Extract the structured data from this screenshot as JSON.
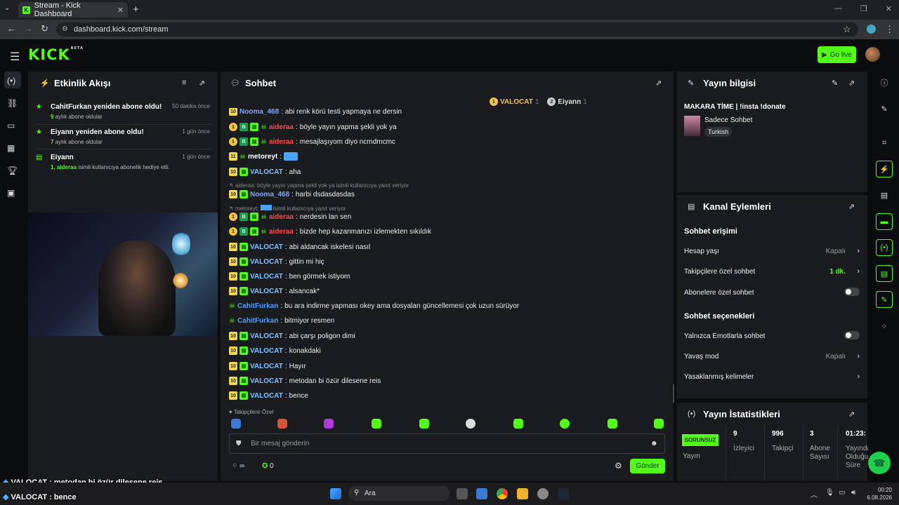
{
  "browser": {
    "tab_title": "Stream - Kick Dashboard",
    "url": "dashboard.kick.com/stream"
  },
  "header": {
    "logo": "KICK",
    "logo_beta": "BETA",
    "go_live": "Go live"
  },
  "activity": {
    "title": "Etkinlik Akışı",
    "items": [
      {
        "title": "CahitFurkan yeniden abone oldu!",
        "count": "9",
        "sub": "aylık abone oldular",
        "when": "50 dakika önce"
      },
      {
        "title": "Eiyann yeniden abone oldu!",
        "count": "7",
        "sub": "aylık abone oldular",
        "when": "1 gün önce"
      },
      {
        "title": "Eiyann",
        "count": "1, aideraa",
        "sub": "isimli kullanıcıya abonelik hediye etti.",
        "when": "1 gün önce"
      }
    ]
  },
  "chat": {
    "title": "Sohbet",
    "pinned": [
      {
        "rank": "1",
        "name": "VALOCAT",
        "count": "1"
      },
      {
        "rank": "2",
        "name": "Eiyann",
        "count": "1"
      }
    ],
    "messages": [
      {
        "name": "Nooma_468",
        "text": "abi renk körü testi yapmaya ne dersin",
        "color": "#7fa7ff"
      },
      {
        "name": "aideraa",
        "text": "böyle yayın yapma şekli yok ya",
        "color": "#ff4a4a"
      },
      {
        "name": "aideraa",
        "text": "mesajlaşıyom diyo ncmdmcmc",
        "color": "#ff4a4a"
      },
      {
        "name": "metoreyt",
        "text": "",
        "color": "#ffffff"
      },
      {
        "name": "VALOCAT",
        "text": "aha",
        "color": "#7fc4ff"
      },
      {
        "name": "Nooma_468",
        "text": "harbi dsdasdasdas",
        "color": "#7fa7ff"
      },
      {
        "name": "aideraa",
        "text": "nerdesin lan sen",
        "color": "#ff4a4a"
      },
      {
        "name": "aideraa",
        "text": "bizde hep kazanmanızı izlemekten sıkıldık",
        "color": "#ff4a4a"
      },
      {
        "name": "VALOCAT",
        "text": "abi aldancak iskelesi nasıl",
        "color": "#7fc4ff"
      },
      {
        "name": "VALOCAT",
        "text": "gittin mi hiç",
        "color": "#7fc4ff"
      },
      {
        "name": "VALOCAT",
        "text": "ben görmek istiyom",
        "color": "#7fc4ff"
      },
      {
        "name": "VALOCAT",
        "text": "alsancak*",
        "color": "#7fc4ff"
      },
      {
        "name": "CahitFurkan",
        "text": "bu ara indirme yapması okey ama dosyaları güncellemesi çok uzun sürüyor",
        "color": "#4d9eff"
      },
      {
        "name": "CahitFurkan",
        "text": "bitmiyor resmen",
        "color": "#4d9eff"
      },
      {
        "name": "VALOCAT",
        "text": "abi çarşı poligon dimi",
        "color": "#7fc4ff"
      },
      {
        "name": "VALOCAT",
        "text": "konakdaki",
        "color": "#7fc4ff"
      },
      {
        "name": "VALOCAT",
        "text": "Hayır",
        "color": "#7fc4ff"
      },
      {
        "name": "VALOCAT",
        "text": "metodan bi özür dilesene reis",
        "color": "#7fc4ff"
      },
      {
        "name": "VALOCAT",
        "text": "bence",
        "color": "#7fc4ff"
      }
    ],
    "reply1_user": "aideraa",
    "reply1_text": "böyle yayın yapma şekli yok ya isimli kullanıcıya yanıt veriyor",
    "reply2_user": "metoreyt",
    "reply2_text": "isimli kullanıcıya yanıt veriyor",
    "followers_only": "Takipçilere Özel",
    "placeholder": "Bir mesaj gönderin",
    "send": "Gönder",
    "infinity": "∞",
    "points": "0"
  },
  "stream_info": {
    "title": "Yayın bilgisi",
    "stream_title": "MAKARA TİME | !insta !donate",
    "category": "Sadece Sohbet",
    "language": "Turkish"
  },
  "channel_actions": {
    "title": "Kanal Eylemleri",
    "chat_access": "Sohbet erişimi",
    "account_age": "Hesap yaşı",
    "account_age_value": "Kapalı",
    "followers_chat": "Takipçilere özel sohbet",
    "followers_chat_value": "1 dk.",
    "subs_chat": "Abonelere özel sohbet",
    "chat_options": "Sohbet seçenekleri",
    "emote_only": "Yalnızca Emotlarla sohbet",
    "slow_mode": "Yavaş mod",
    "slow_mode_value": "Kapalı",
    "banned_words": "Yasaklanmış kelimeler"
  },
  "stats": {
    "title": "Yayın İstatistikleri",
    "status": "SORUNSUZ",
    "status_label": "Yayın",
    "viewers": "9",
    "viewers_label": "İzleyici",
    "followers": "996",
    "followers_label": "Takipçi",
    "subs": "3",
    "subs_label": "Abone Sayısı",
    "duration": "01:23:",
    "duration_label": "Yayında Olduğu Süre"
  },
  "overlay": [
    {
      "user": "VALOCAT",
      "text": ": metodan bi özür dilesene reis"
    },
    {
      "user": "VALOCAT",
      "text": ": bence"
    }
  ],
  "taskbar": {
    "search": "Ara",
    "time": "00:20",
    "date": "6.08.2026"
  }
}
